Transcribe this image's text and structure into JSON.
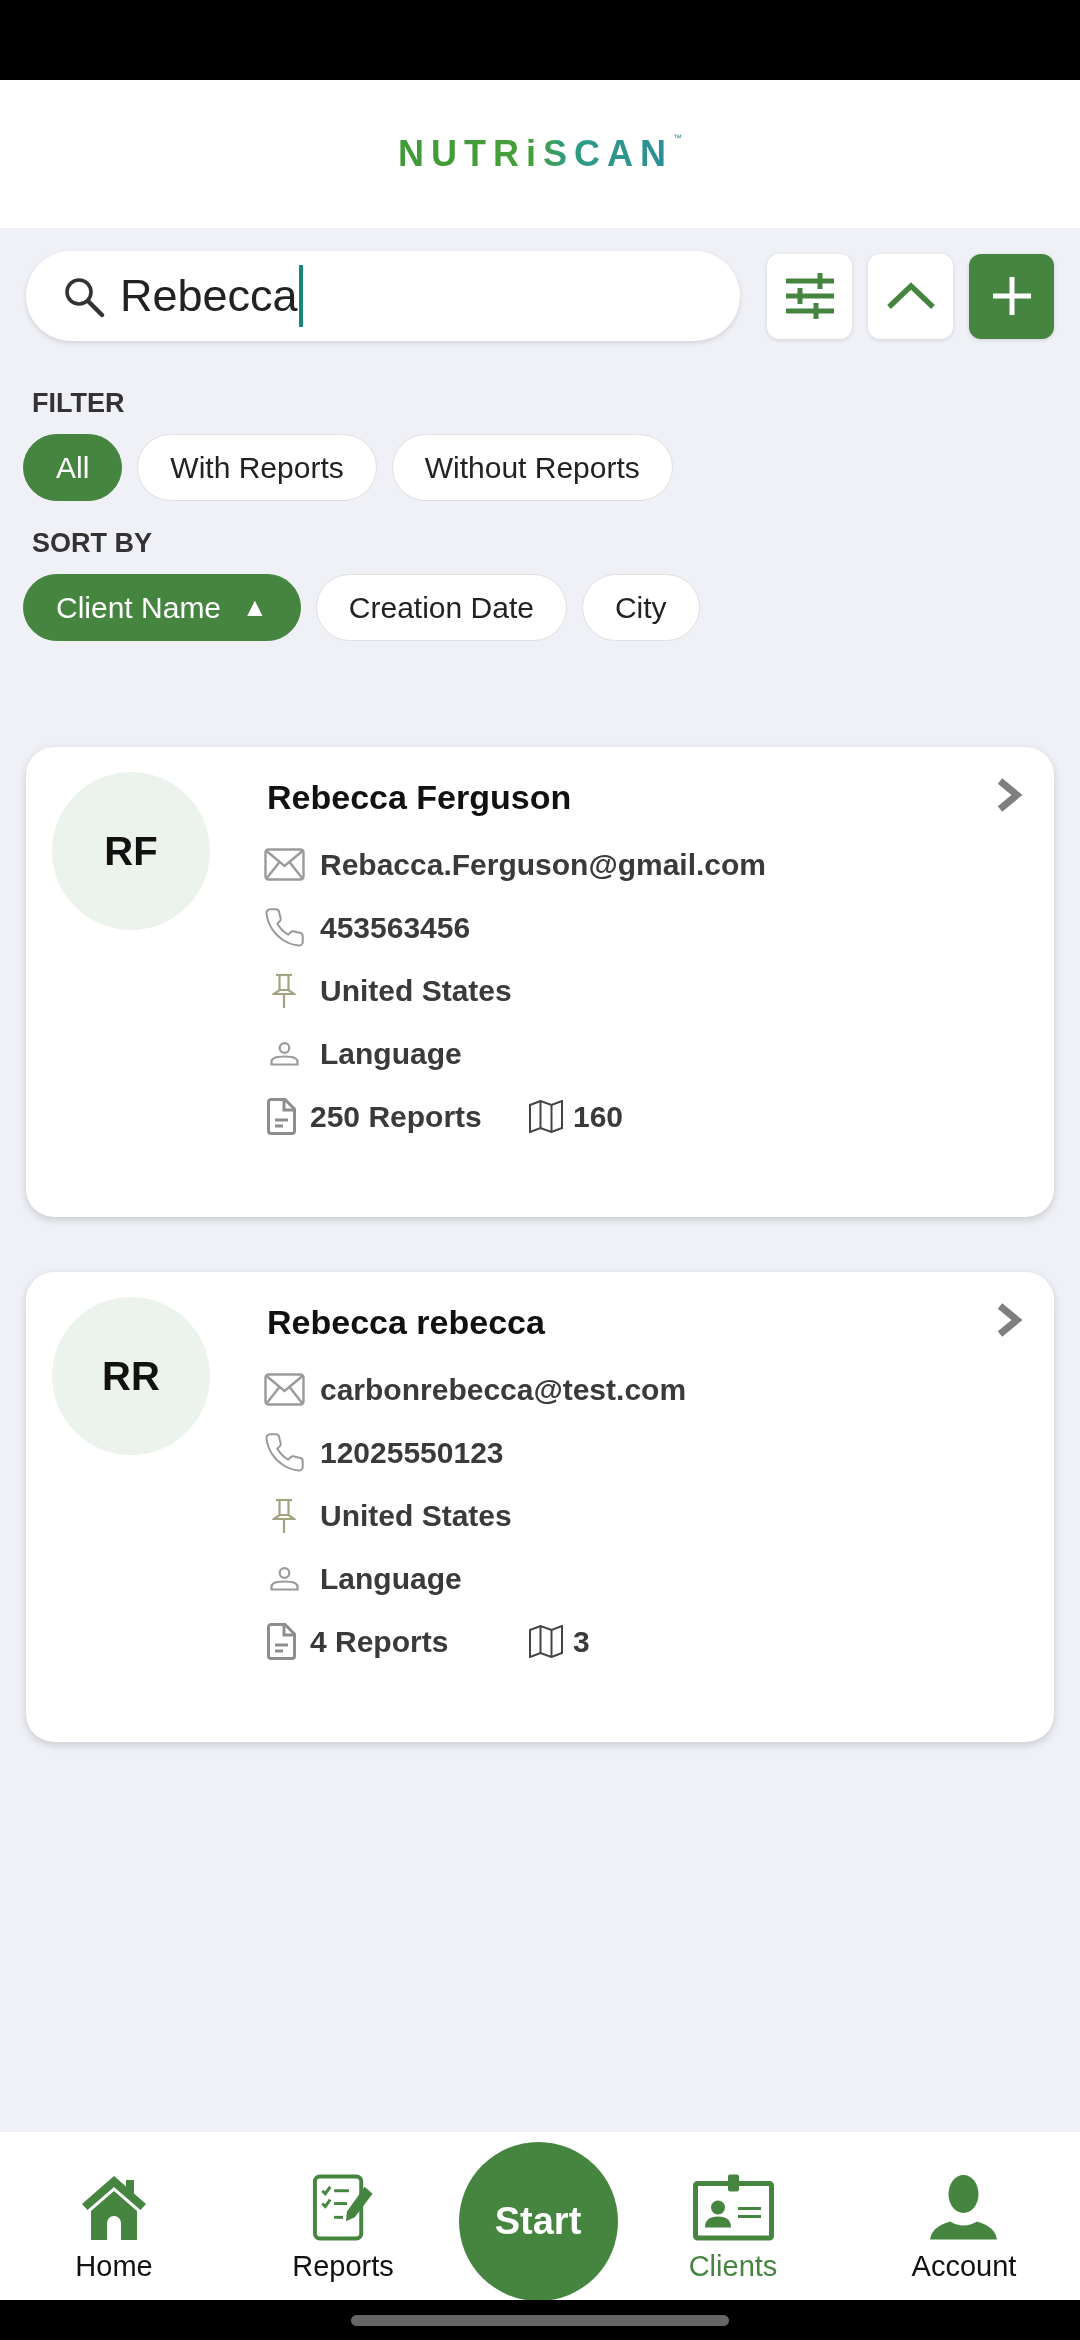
{
  "header": {
    "logo": {
      "text": "NUTRiSCAN",
      "trademark": "™"
    }
  },
  "search": {
    "value": "Rebecca",
    "focused": true
  },
  "filter": {
    "label": "FILTER",
    "chips": [
      {
        "label": "All",
        "selected": true
      },
      {
        "label": "With Reports",
        "selected": false
      },
      {
        "label": "Without Reports",
        "selected": false
      }
    ]
  },
  "sort": {
    "label": "SORT BY",
    "chips": [
      {
        "label": "Client Name",
        "selected": true,
        "direction": "▲"
      },
      {
        "label": "Creation Date",
        "selected": false
      },
      {
        "label": "City",
        "selected": false
      }
    ]
  },
  "clients": [
    {
      "initials": "RF",
      "name": "Rebecca Ferguson",
      "email": "Rebacca.Ferguson@gmail.com",
      "phone": "453563456",
      "country": "United States",
      "language": "Language",
      "reports": "250 Reports",
      "maps": "160"
    },
    {
      "initials": "RR",
      "name": "Rebecca rebecca",
      "email": "carbonrebecca@test.com",
      "phone": "12025550123",
      "country": "United States",
      "language": "Language",
      "reports": "4 Reports",
      "maps": "3"
    }
  ],
  "bottom_nav": {
    "items": [
      {
        "kind": "tab",
        "label": "Home",
        "selected": false
      },
      {
        "kind": "tab",
        "label": "Reports",
        "selected": false
      },
      {
        "kind": "action",
        "label": "Start"
      },
      {
        "kind": "tab",
        "label": "Clients",
        "selected": true
      },
      {
        "kind": "tab",
        "label": "Account",
        "selected": false
      }
    ]
  }
}
